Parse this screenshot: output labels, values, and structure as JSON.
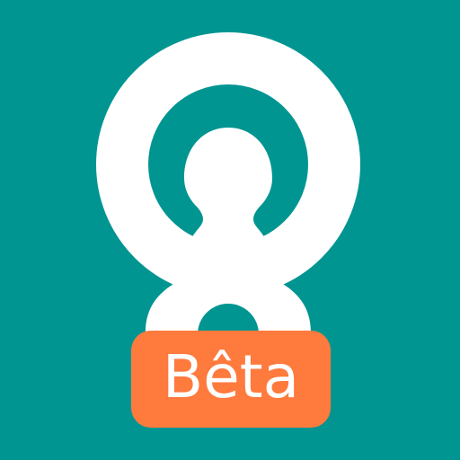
{
  "icon": {
    "background_color": "#009591",
    "logo_color": "#ffffff",
    "logo_name": "person-in-circle-logo-icon"
  },
  "badge": {
    "label": "Bêta",
    "color": "#fe7a3d",
    "text_color": "#ffffff"
  }
}
